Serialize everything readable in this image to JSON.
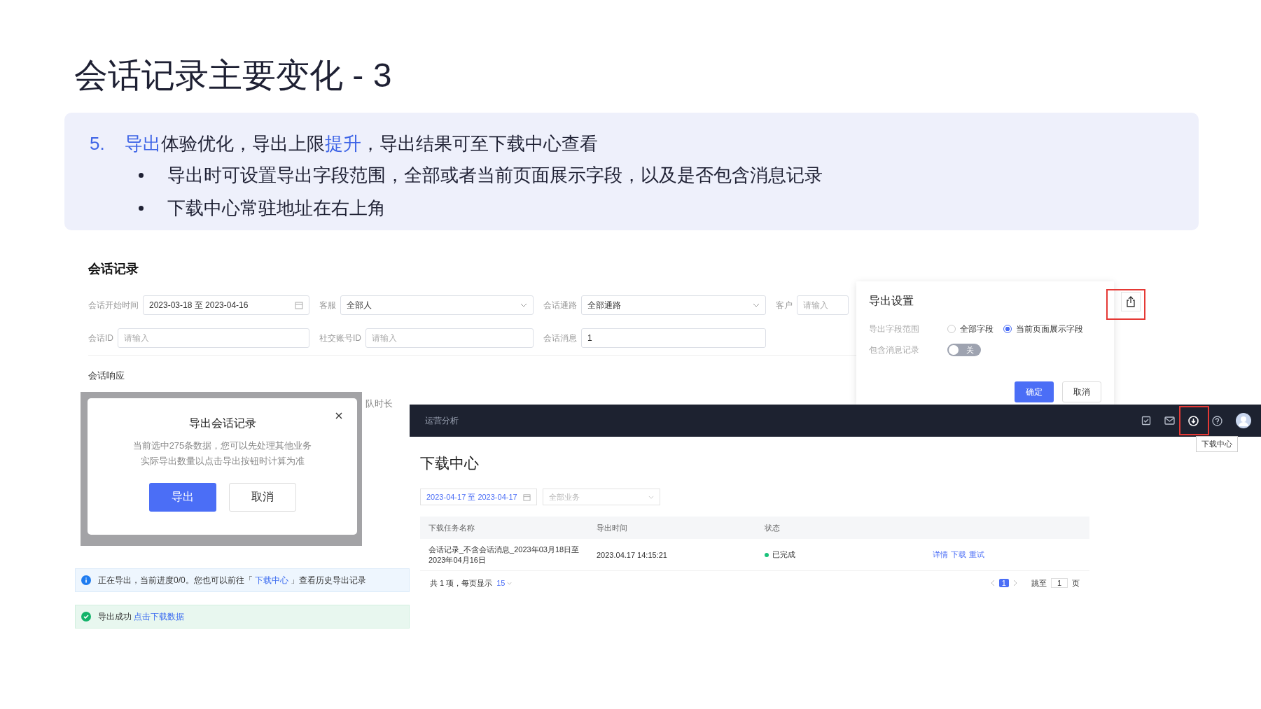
{
  "slide": {
    "title": "会话记录主要变化 - 3",
    "point": {
      "number": "5.",
      "text": "**导出**体验优化，导出上限**提升**，导出结果可至下载中心查看"
    },
    "bullets": [
      "导出时可设置导出字段范围，全部或者当前页面展示字段，以及是否包含消息记录",
      "下载中心常驻地址在右上角"
    ]
  },
  "conversation_records": {
    "title": "会话记录",
    "filters": [
      {
        "label": "会话开始时间",
        "kind": "date",
        "value": "2023-03-18 至 2023-04-16"
      },
      {
        "label": "客服",
        "kind": "select",
        "value": "全部人"
      },
      {
        "label": "会话通路",
        "kind": "select",
        "value": "全部通路"
      },
      {
        "label": "客户",
        "kind": "input",
        "placeholder": "请输入"
      },
      {
        "label": "会话ID",
        "kind": "input",
        "placeholder": "请输入"
      },
      {
        "label": "社交账号ID",
        "kind": "input",
        "placeholder": "请输入"
      },
      {
        "label": "会话消息",
        "kind": "input",
        "value": "1"
      }
    ],
    "section_label": "会话响应",
    "partial_label": "队时长"
  },
  "export_settings": {
    "title": "导出设置",
    "range_label": "导出字段范围",
    "options": [
      {
        "label": "全部字段",
        "selected": false
      },
      {
        "label": "当前页面展示字段",
        "selected": true
      }
    ],
    "include_label": "包含消息记录",
    "toggle": {
      "on": false,
      "text": "关"
    },
    "buttons": [
      "确定",
      "取消"
    ],
    "export_button_highlighted": true
  },
  "top_bar": {
    "title": "运营分析",
    "download_highlighted": true,
    "tooltip": "下载中心"
  },
  "download_center": {
    "title": "下载中心",
    "date_range": "2023-04-17 至 2023-04-17",
    "business_placeholder": "全部业务",
    "columns": [
      "下载任务名称",
      "导出时间",
      "状态"
    ],
    "rows": [
      {
        "name": "会话记录_不含会话消息_2023年03月18日至2023年04月16日",
        "time": "2023.04.17 14:15:21",
        "status": "已完成",
        "color": "#19c27a",
        "actions": [
          "详情",
          "下载",
          "重试"
        ]
      }
    ],
    "footer": {
      "total": "共 1 项，每页显示",
      "page_size": "15",
      "page": "1",
      "jump_label": "跳至",
      "jump_value": "1",
      "page_unit": "页"
    }
  },
  "export_dialog": {
    "title": "导出会话记录",
    "message": [
      "当前选中275条数据，您可以先处理其他业务",
      "实际导出数量以点击导出按钮时计算为准"
    ],
    "buttons": [
      "导出",
      "取消"
    ]
  },
  "alerts": [
    {
      "kind": "info",
      "before": "正在导出，当前进度0/0。您也可以前往「 ",
      "link": "下载中心",
      "after": " 」查看历史导出记录"
    },
    {
      "kind": "success",
      "before": "导出成功 ",
      "link": "点击下载数据"
    }
  ]
}
